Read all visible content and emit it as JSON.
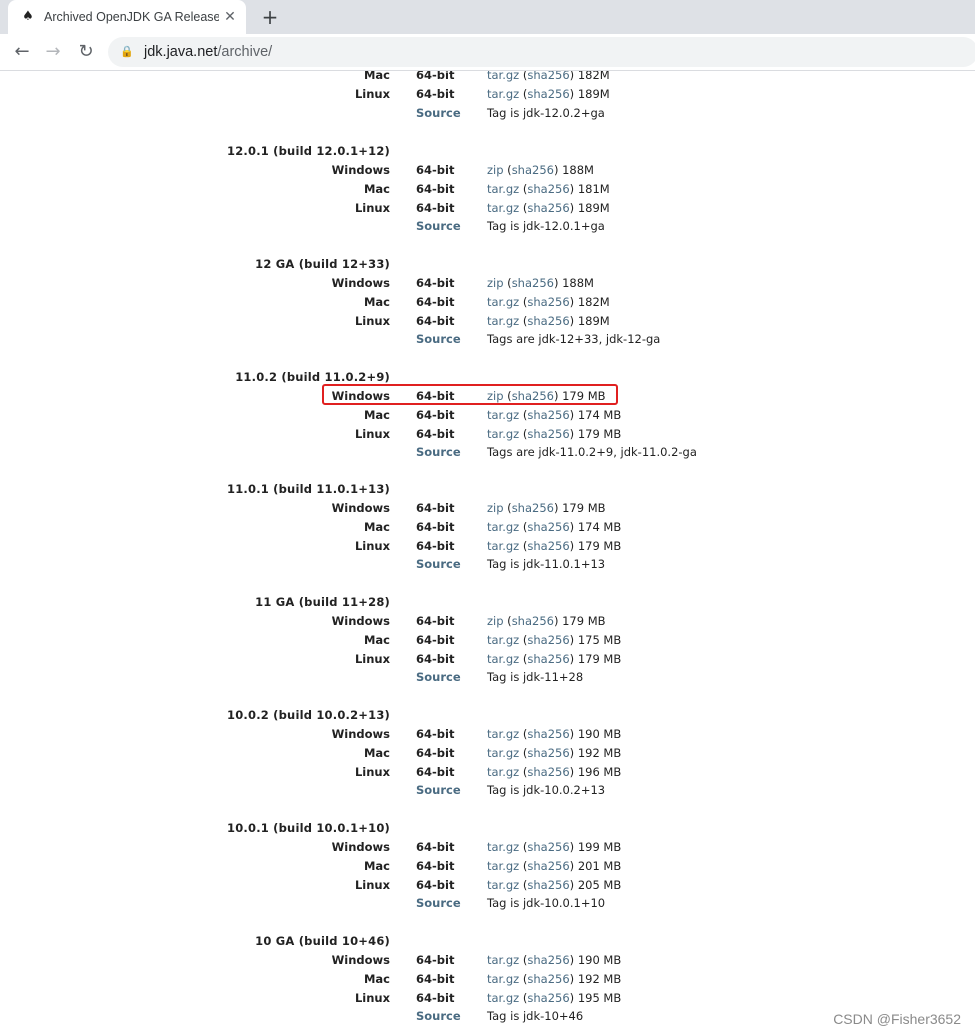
{
  "browser": {
    "tab_title": "Archived OpenJDK GA Release",
    "url_host": "jdk.java.net",
    "url_path": "/archive/"
  },
  "watermark": "CSDN @Fisher3652",
  "labels": {
    "bits": "64-bit",
    "source": "Source",
    "sha": "sha256"
  },
  "partial_top": [
    {
      "os": "Mac",
      "link": "tar.gz",
      "size": "182M"
    },
    {
      "os": "Linux",
      "link": "tar.gz",
      "size": "189M"
    },
    {
      "source": "Tag is jdk-12.0.2+ga"
    }
  ],
  "releases": [
    {
      "title": "12.0.1 (build 12.0.1+12)",
      "rows": [
        {
          "os": "Windows",
          "link": "zip",
          "size": "188M"
        },
        {
          "os": "Mac",
          "link": "tar.gz",
          "size": "181M"
        },
        {
          "os": "Linux",
          "link": "tar.gz",
          "size": "189M"
        }
      ],
      "source": "Tag is jdk-12.0.1+ga"
    },
    {
      "title": "12 GA (build 12+33)",
      "rows": [
        {
          "os": "Windows",
          "link": "zip",
          "size": "188M"
        },
        {
          "os": "Mac",
          "link": "tar.gz",
          "size": "182M"
        },
        {
          "os": "Linux",
          "link": "tar.gz",
          "size": "189M"
        }
      ],
      "source": "Tags are jdk-12+33, jdk-12-ga"
    },
    {
      "title": "11.0.2 (build 11.0.2+9)",
      "rows": [
        {
          "os": "Windows",
          "link": "zip",
          "size": "179 MB"
        },
        {
          "os": "Mac",
          "link": "tar.gz",
          "size": "174 MB"
        },
        {
          "os": "Linux",
          "link": "tar.gz",
          "size": "179 MB"
        }
      ],
      "source": "Tags are jdk-11.0.2+9, jdk-11.0.2-ga"
    },
    {
      "title": "11.0.1 (build 11.0.1+13)",
      "rows": [
        {
          "os": "Windows",
          "link": "zip",
          "size": "179 MB"
        },
        {
          "os": "Mac",
          "link": "tar.gz",
          "size": "174 MB"
        },
        {
          "os": "Linux",
          "link": "tar.gz",
          "size": "179 MB"
        }
      ],
      "source": "Tag is jdk-11.0.1+13"
    },
    {
      "title": "11 GA (build 11+28)",
      "rows": [
        {
          "os": "Windows",
          "link": "zip",
          "size": "179 MB"
        },
        {
          "os": "Mac",
          "link": "tar.gz",
          "size": "175 MB"
        },
        {
          "os": "Linux",
          "link": "tar.gz",
          "size": "179 MB"
        }
      ],
      "source": "Tag is jdk-11+28"
    },
    {
      "title": "10.0.2 (build 10.0.2+13)",
      "rows": [
        {
          "os": "Windows",
          "link": "tar.gz",
          "size": "190 MB"
        },
        {
          "os": "Mac",
          "link": "tar.gz",
          "size": "192 MB"
        },
        {
          "os": "Linux",
          "link": "tar.gz",
          "size": "196 MB"
        }
      ],
      "source": "Tag is jdk-10.0.2+13"
    },
    {
      "title": "10.0.1 (build 10.0.1+10)",
      "rows": [
        {
          "os": "Windows",
          "link": "tar.gz",
          "size": "199 MB"
        },
        {
          "os": "Mac",
          "link": "tar.gz",
          "size": "201 MB"
        },
        {
          "os": "Linux",
          "link": "tar.gz",
          "size": "205 MB"
        }
      ],
      "source": "Tag is jdk-10.0.1+10"
    },
    {
      "title": "10 GA (build 10+46)",
      "rows": [
        {
          "os": "Windows",
          "link": "tar.gz",
          "size": "190 MB"
        },
        {
          "os": "Mac",
          "link": "tar.gz",
          "size": "192 MB"
        },
        {
          "os": "Linux",
          "link": "tar.gz",
          "size": "195 MB"
        }
      ],
      "source": "Tag is jdk-10+46"
    }
  ]
}
